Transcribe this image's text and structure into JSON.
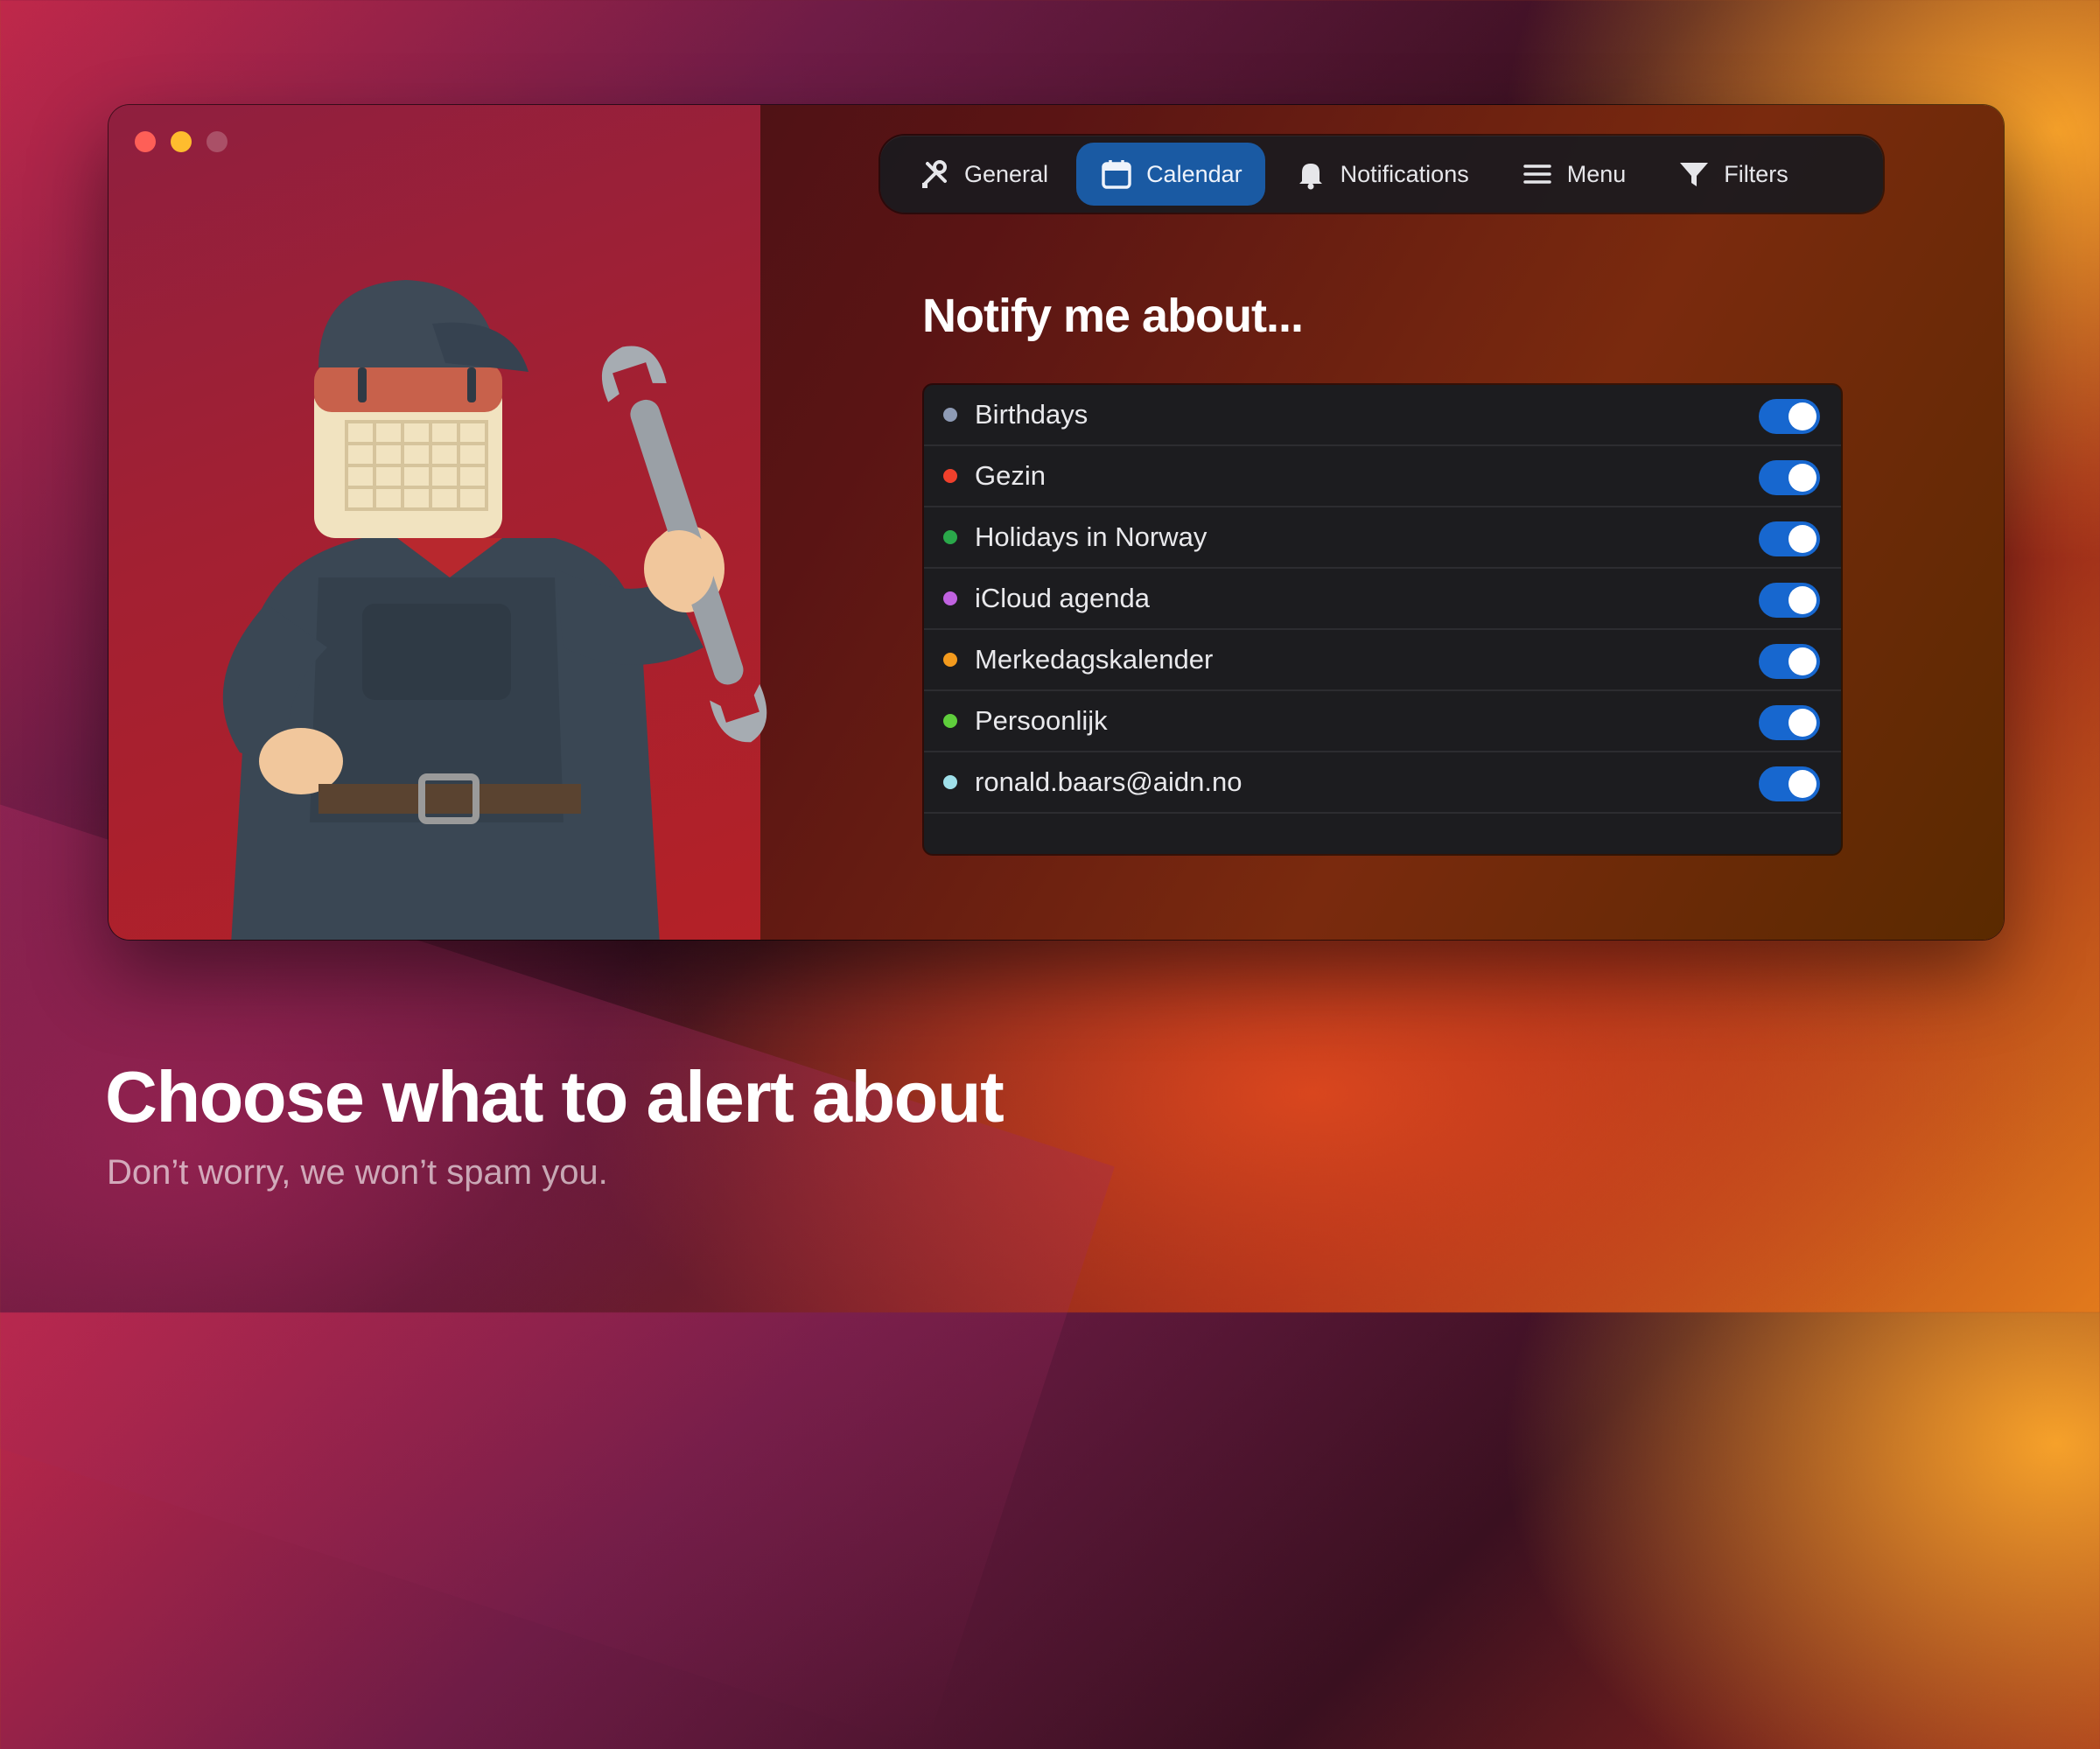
{
  "toolbar": {
    "tabs": [
      {
        "label": "General",
        "icon": "wrench-screwdriver-icon",
        "active": false
      },
      {
        "label": "Calendar",
        "icon": "calendar-icon",
        "active": true
      },
      {
        "label": "Notifications",
        "icon": "bell-icon",
        "active": false
      },
      {
        "label": "Menu",
        "icon": "hamburger-menu-icon",
        "active": false
      },
      {
        "label": "Filters",
        "icon": "funnel-icon",
        "active": false
      }
    ]
  },
  "main": {
    "heading": "Notify me about...",
    "calendars": [
      {
        "name": "Birthdays",
        "color": "#8e9bb5",
        "enabled": true
      },
      {
        "name": "Gezin",
        "color": "#f0402c",
        "enabled": true
      },
      {
        "name": "Holidays in Norway",
        "color": "#2aa84a",
        "enabled": true
      },
      {
        "name": "iCloud agenda",
        "color": "#c062e0",
        "enabled": true
      },
      {
        "name": "Merkedagskalender",
        "color": "#f39a1d",
        "enabled": true
      },
      {
        "name": "Persoonlijk",
        "color": "#5fce3c",
        "enabled": true
      },
      {
        "name": "ronald.baars@aidn.no",
        "color": "#9fe0ea",
        "enabled": true
      }
    ]
  },
  "caption": {
    "title": "Choose what to alert about",
    "subtitle": "Don’t worry, we won’t spam you."
  },
  "colors": {
    "accent": "#1767cf",
    "active_tab": "#1a5aa3",
    "list_bg": "#1c1c1f"
  }
}
